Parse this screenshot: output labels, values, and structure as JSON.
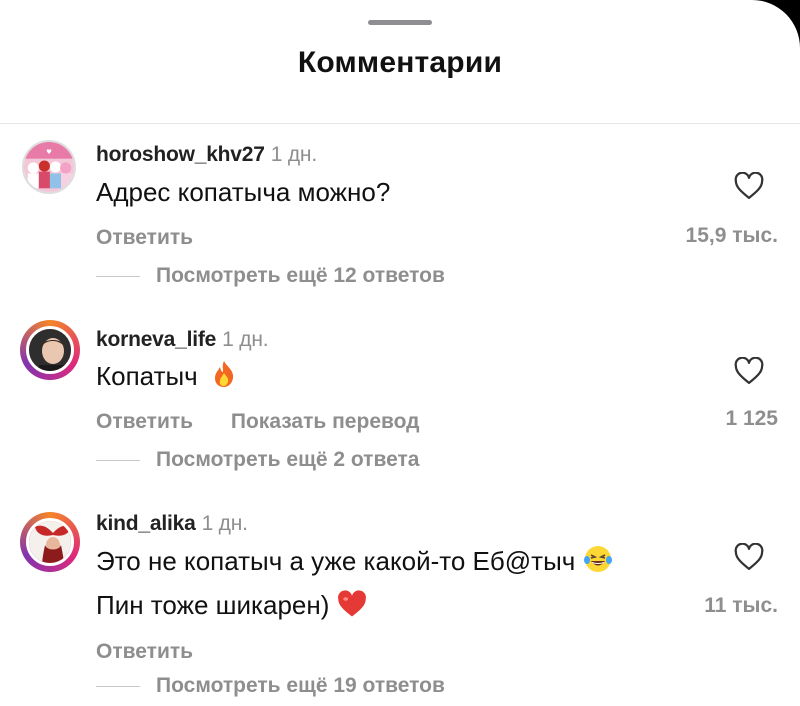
{
  "header": {
    "title": "Комментарии"
  },
  "comments": [
    {
      "username": "horoshow_khv27",
      "time": "1 дн.",
      "text": "Адрес копатыча можно?",
      "actions": [
        "Ответить"
      ],
      "likes": "15,9 тыс.",
      "more": "Посмотреть ещё 12 ответов",
      "avatar_icon": "group-photo-avatar"
    },
    {
      "username": "korneva_life",
      "time": "1 дн.",
      "text": "Копатыч",
      "emoji": "fire-emoji",
      "actions": [
        "Ответить",
        "Показать перевод"
      ],
      "likes": "1 125",
      "more": "Посмотреть ещё 2 ответа",
      "avatar_icon": "portrait-avatar"
    },
    {
      "username": "kind_alika",
      "time": "1 дн.",
      "text_line1": "Это не копатыч а уже какой-то Еб@тыч",
      "text_line2": "Пин тоже шикарен)",
      "emoji1": "laughing-tears-emoji",
      "emoji2": "red-heart-emoji",
      "actions": [
        "Ответить"
      ],
      "likes": "11 тыс.",
      "more": "Посмотреть ещё 19 ответов",
      "avatar_icon": "bow-avatar"
    }
  ],
  "colors": {
    "muted": "#8e8e8e",
    "text": "#111111",
    "ring_start": "#f58529",
    "ring_mid": "#dd2a7b"
  }
}
